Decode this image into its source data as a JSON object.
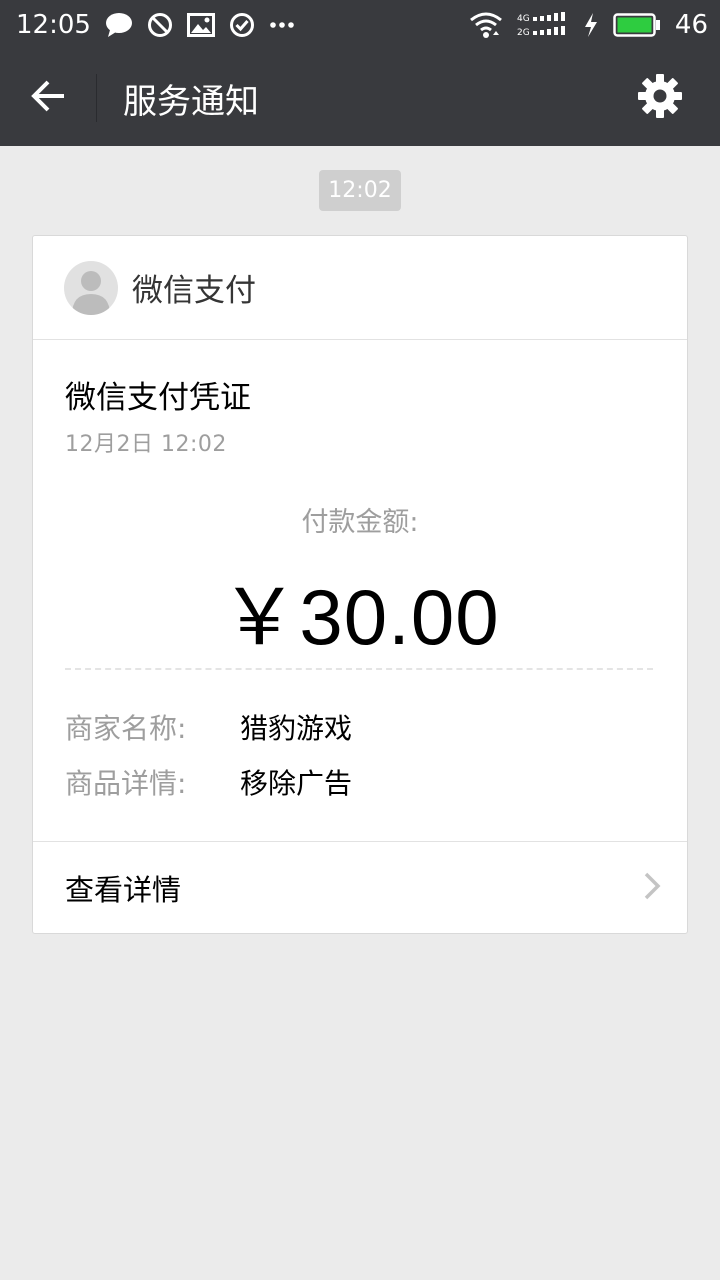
{
  "status_bar": {
    "time": "12:05",
    "battery_level": "46",
    "net_4g": "4G",
    "net_2g": "2G",
    "icons": [
      "chat-bubble-icon",
      "blocked-icon",
      "image-icon",
      "check-circle-icon",
      "more-dots-icon",
      "wifi-icon",
      "signal-icon",
      "charging-icon",
      "battery-icon"
    ],
    "battery_color": "#2ecc40"
  },
  "app_bar": {
    "title": "服务通知",
    "back_icon": "back-arrow-icon",
    "settings_icon": "gear-icon"
  },
  "timestamp": "12:02",
  "card": {
    "sender": "微信支付",
    "title": "微信支付凭证",
    "date": "12月2日  12:02",
    "amount_label": "付款金额:",
    "amount": "￥30.00",
    "details": [
      {
        "key": "商家名称:",
        "value": "猎豹游戏"
      },
      {
        "key": "商品详情:",
        "value": "移除广告"
      }
    ],
    "footer_label": "查看详情",
    "footer_icon": "chevron-right-icon"
  },
  "colors": {
    "bar_bg": "#393a3e",
    "page_bg": "#ebebeb",
    "secondary_text": "#9e9e9e"
  }
}
